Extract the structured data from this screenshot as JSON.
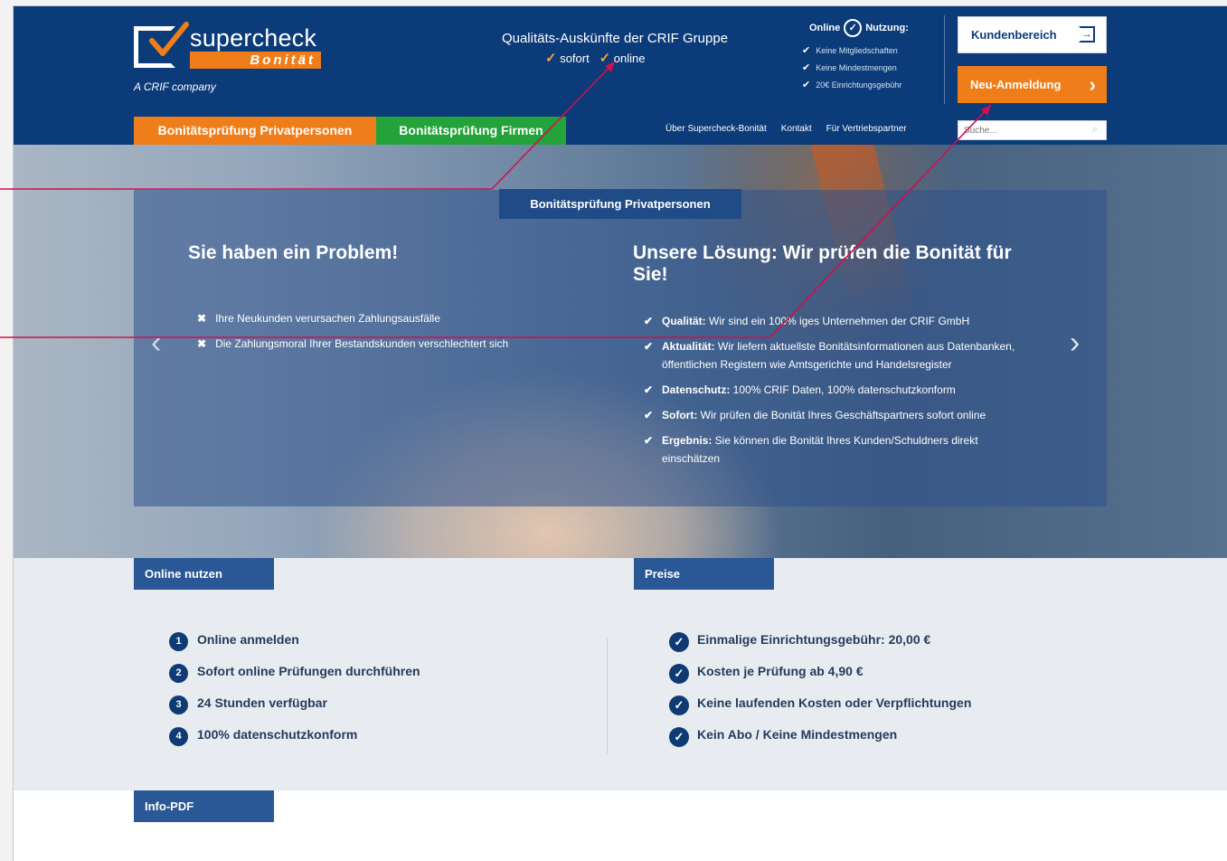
{
  "header": {
    "logo": {
      "word": "supercheck",
      "bonitat": "Bonität",
      "sub": "A CRIF company"
    },
    "tagline": "Qualitäts-Auskünfte der CRIF Gruppe",
    "tagline_items": [
      "sofort",
      "online"
    ],
    "usage": {
      "online": "Online",
      "nutzung": "Nutzung:",
      "items": [
        "Keine Mitgliedschaften",
        "Keine Mindestmengen",
        "20€ Einrichtungsgebühr"
      ]
    },
    "kunden_label": "Kundenbereich",
    "neu_label": "Neu-Anmeldung",
    "search_placeholder": "Suche...",
    "tabs": [
      "Bonitätsprüfung Privatpersonen",
      "Bonitätsprüfung Firmen"
    ],
    "nav": [
      "Über Supercheck-Bonität",
      "Kontakt",
      "Für Vertriebspartner"
    ]
  },
  "hero": {
    "panel_tab": "Bonitätsprüfung Privatpersonen",
    "left_title": "Sie haben ein Problem!",
    "left_items": [
      "Ihre Neukunden verursachen Zahlungsausfälle",
      "Die Zahlungsmoral Ihrer Bestandskunden verschlechtert sich"
    ],
    "right_title": "Unsere Lösung: Wir prüfen die Bonität für Sie!",
    "right_items": [
      {
        "label": "Qualität:",
        "text": " Wir sind ein 100% iges Unternehmen der CRIF GmbH"
      },
      {
        "label": "Aktualität:",
        "text": " Wir liefern aktuellste Bonitätsinformationen aus Datenbanken, öffentlichen Registern wie Amtsgerichte und Handelsregister"
      },
      {
        "label": "Datenschutz:",
        "text": " 100% CRIF Daten, 100% datenschutzkonform"
      },
      {
        "label": "Sofort:",
        "text": " Wir prüfen die Bonität Ihres Geschäftspartners sofort online"
      },
      {
        "label": "Ergebnis:",
        "text": " Sie können die Bonität Ihres Kunden/Schuldners direkt einschätzen"
      }
    ]
  },
  "online": {
    "tab": "Online nutzen",
    "items": [
      {
        "num": "1",
        "text": "Online anmelden"
      },
      {
        "num": "2",
        "text": "Sofort online Prüfungen durchführen"
      },
      {
        "num": "3",
        "text": "24 Stunden verfügbar"
      },
      {
        "num": "4",
        "text": "100% datenschutzkonform"
      }
    ]
  },
  "preise": {
    "tab": "Preise",
    "items": [
      "Einmalige Einrichtungsgebühr: 20,00 €",
      "Kosten je Prüfung ab 4,90 €",
      "Keine laufenden Kosten oder Verpflichtungen",
      "Kein Abo / Keine Mindestmengen"
    ]
  },
  "infopdf": {
    "tab": "Info-PDF"
  },
  "colors": {
    "brand_blue": "#0b3b78",
    "orange": "#ef7d1a",
    "green": "#24a33b",
    "annotation": "#d0104c"
  }
}
